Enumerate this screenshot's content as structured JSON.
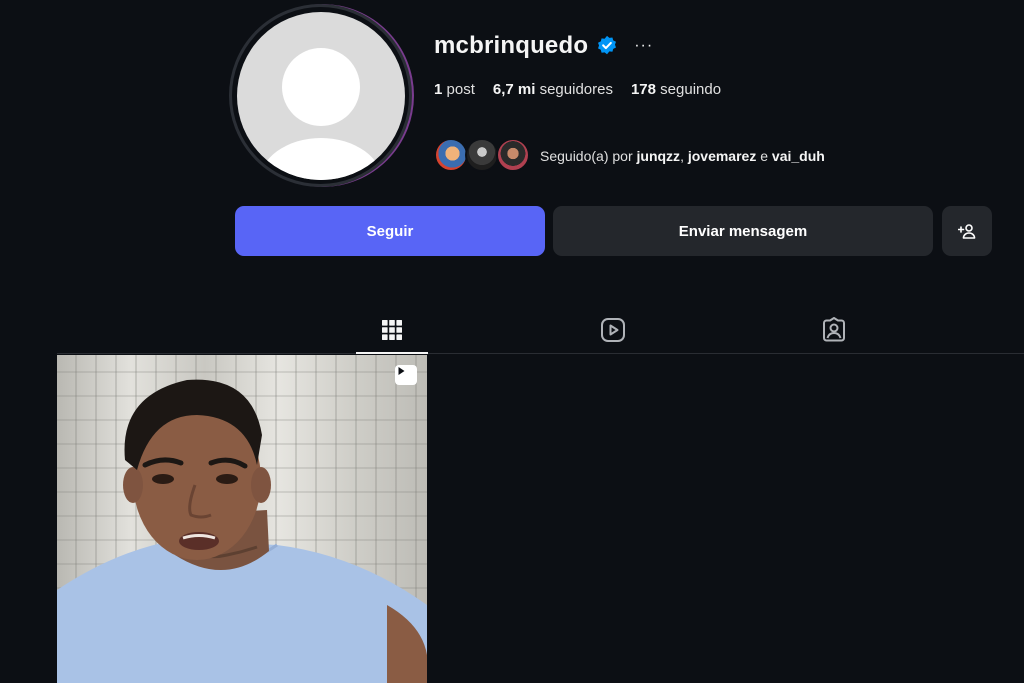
{
  "profile": {
    "username": "mcbrinquedo",
    "verified": true,
    "more_label": "···",
    "stats": {
      "posts_value": "1",
      "posts_label": "post",
      "followers_value": "6,7 mi",
      "followers_label": "seguidores",
      "following_value": "178",
      "following_label": "seguindo"
    },
    "followed_by": {
      "prefix": "Seguido(a) por",
      "user1": "junqzz",
      "user2": "jovemarez",
      "connector": "e",
      "user3": "vai_duh"
    }
  },
  "actions": {
    "follow_label": "Seguir",
    "message_label": "Enviar mensagem",
    "suggest_icon": "person-plus-icon"
  },
  "tabs": [
    {
      "icon": "grid-icon",
      "active": true
    },
    {
      "icon": "reels-icon",
      "active": false
    },
    {
      "icon": "tagged-icon",
      "active": false
    }
  ],
  "colors": {
    "background": "#0c0f14",
    "follow_button": "#5865f6",
    "secondary_button": "#24272c",
    "verified_badge": "#0095f6"
  }
}
